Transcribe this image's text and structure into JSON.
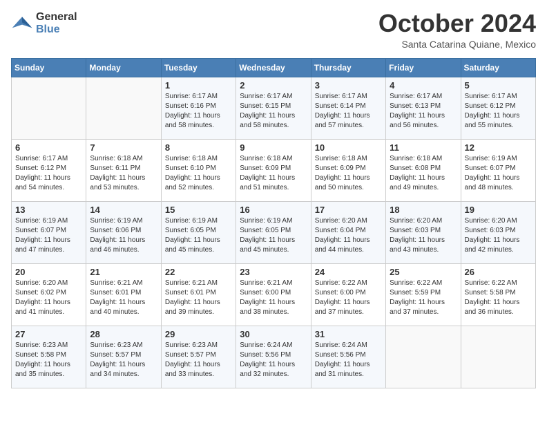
{
  "header": {
    "logo_line1": "General",
    "logo_line2": "Blue",
    "month": "October 2024",
    "location": "Santa Catarina Quiane, Mexico"
  },
  "weekdays": [
    "Sunday",
    "Monday",
    "Tuesday",
    "Wednesday",
    "Thursday",
    "Friday",
    "Saturday"
  ],
  "weeks": [
    [
      {
        "day": "",
        "sunrise": "",
        "sunset": "",
        "daylight": ""
      },
      {
        "day": "",
        "sunrise": "",
        "sunset": "",
        "daylight": ""
      },
      {
        "day": "1",
        "sunrise": "Sunrise: 6:17 AM",
        "sunset": "Sunset: 6:16 PM",
        "daylight": "Daylight: 11 hours and 58 minutes."
      },
      {
        "day": "2",
        "sunrise": "Sunrise: 6:17 AM",
        "sunset": "Sunset: 6:15 PM",
        "daylight": "Daylight: 11 hours and 58 minutes."
      },
      {
        "day": "3",
        "sunrise": "Sunrise: 6:17 AM",
        "sunset": "Sunset: 6:14 PM",
        "daylight": "Daylight: 11 hours and 57 minutes."
      },
      {
        "day": "4",
        "sunrise": "Sunrise: 6:17 AM",
        "sunset": "Sunset: 6:13 PM",
        "daylight": "Daylight: 11 hours and 56 minutes."
      },
      {
        "day": "5",
        "sunrise": "Sunrise: 6:17 AM",
        "sunset": "Sunset: 6:12 PM",
        "daylight": "Daylight: 11 hours and 55 minutes."
      }
    ],
    [
      {
        "day": "6",
        "sunrise": "Sunrise: 6:17 AM",
        "sunset": "Sunset: 6:12 PM",
        "daylight": "Daylight: 11 hours and 54 minutes."
      },
      {
        "day": "7",
        "sunrise": "Sunrise: 6:18 AM",
        "sunset": "Sunset: 6:11 PM",
        "daylight": "Daylight: 11 hours and 53 minutes."
      },
      {
        "day": "8",
        "sunrise": "Sunrise: 6:18 AM",
        "sunset": "Sunset: 6:10 PM",
        "daylight": "Daylight: 11 hours and 52 minutes."
      },
      {
        "day": "9",
        "sunrise": "Sunrise: 6:18 AM",
        "sunset": "Sunset: 6:09 PM",
        "daylight": "Daylight: 11 hours and 51 minutes."
      },
      {
        "day": "10",
        "sunrise": "Sunrise: 6:18 AM",
        "sunset": "Sunset: 6:09 PM",
        "daylight": "Daylight: 11 hours and 50 minutes."
      },
      {
        "day": "11",
        "sunrise": "Sunrise: 6:18 AM",
        "sunset": "Sunset: 6:08 PM",
        "daylight": "Daylight: 11 hours and 49 minutes."
      },
      {
        "day": "12",
        "sunrise": "Sunrise: 6:19 AM",
        "sunset": "Sunset: 6:07 PM",
        "daylight": "Daylight: 11 hours and 48 minutes."
      }
    ],
    [
      {
        "day": "13",
        "sunrise": "Sunrise: 6:19 AM",
        "sunset": "Sunset: 6:07 PM",
        "daylight": "Daylight: 11 hours and 47 minutes."
      },
      {
        "day": "14",
        "sunrise": "Sunrise: 6:19 AM",
        "sunset": "Sunset: 6:06 PM",
        "daylight": "Daylight: 11 hours and 46 minutes."
      },
      {
        "day": "15",
        "sunrise": "Sunrise: 6:19 AM",
        "sunset": "Sunset: 6:05 PM",
        "daylight": "Daylight: 11 hours and 45 minutes."
      },
      {
        "day": "16",
        "sunrise": "Sunrise: 6:19 AM",
        "sunset": "Sunset: 6:05 PM",
        "daylight": "Daylight: 11 hours and 45 minutes."
      },
      {
        "day": "17",
        "sunrise": "Sunrise: 6:20 AM",
        "sunset": "Sunset: 6:04 PM",
        "daylight": "Daylight: 11 hours and 44 minutes."
      },
      {
        "day": "18",
        "sunrise": "Sunrise: 6:20 AM",
        "sunset": "Sunset: 6:03 PM",
        "daylight": "Daylight: 11 hours and 43 minutes."
      },
      {
        "day": "19",
        "sunrise": "Sunrise: 6:20 AM",
        "sunset": "Sunset: 6:03 PM",
        "daylight": "Daylight: 11 hours and 42 minutes."
      }
    ],
    [
      {
        "day": "20",
        "sunrise": "Sunrise: 6:20 AM",
        "sunset": "Sunset: 6:02 PM",
        "daylight": "Daylight: 11 hours and 41 minutes."
      },
      {
        "day": "21",
        "sunrise": "Sunrise: 6:21 AM",
        "sunset": "Sunset: 6:01 PM",
        "daylight": "Daylight: 11 hours and 40 minutes."
      },
      {
        "day": "22",
        "sunrise": "Sunrise: 6:21 AM",
        "sunset": "Sunset: 6:01 PM",
        "daylight": "Daylight: 11 hours and 39 minutes."
      },
      {
        "day": "23",
        "sunrise": "Sunrise: 6:21 AM",
        "sunset": "Sunset: 6:00 PM",
        "daylight": "Daylight: 11 hours and 38 minutes."
      },
      {
        "day": "24",
        "sunrise": "Sunrise: 6:22 AM",
        "sunset": "Sunset: 6:00 PM",
        "daylight": "Daylight: 11 hours and 37 minutes."
      },
      {
        "day": "25",
        "sunrise": "Sunrise: 6:22 AM",
        "sunset": "Sunset: 5:59 PM",
        "daylight": "Daylight: 11 hours and 37 minutes."
      },
      {
        "day": "26",
        "sunrise": "Sunrise: 6:22 AM",
        "sunset": "Sunset: 5:58 PM",
        "daylight": "Daylight: 11 hours and 36 minutes."
      }
    ],
    [
      {
        "day": "27",
        "sunrise": "Sunrise: 6:23 AM",
        "sunset": "Sunset: 5:58 PM",
        "daylight": "Daylight: 11 hours and 35 minutes."
      },
      {
        "day": "28",
        "sunrise": "Sunrise: 6:23 AM",
        "sunset": "Sunset: 5:57 PM",
        "daylight": "Daylight: 11 hours and 34 minutes."
      },
      {
        "day": "29",
        "sunrise": "Sunrise: 6:23 AM",
        "sunset": "Sunset: 5:57 PM",
        "daylight": "Daylight: 11 hours and 33 minutes."
      },
      {
        "day": "30",
        "sunrise": "Sunrise: 6:24 AM",
        "sunset": "Sunset: 5:56 PM",
        "daylight": "Daylight: 11 hours and 32 minutes."
      },
      {
        "day": "31",
        "sunrise": "Sunrise: 6:24 AM",
        "sunset": "Sunset: 5:56 PM",
        "daylight": "Daylight: 11 hours and 31 minutes."
      },
      {
        "day": "",
        "sunrise": "",
        "sunset": "",
        "daylight": ""
      },
      {
        "day": "",
        "sunrise": "",
        "sunset": "",
        "daylight": ""
      }
    ]
  ]
}
